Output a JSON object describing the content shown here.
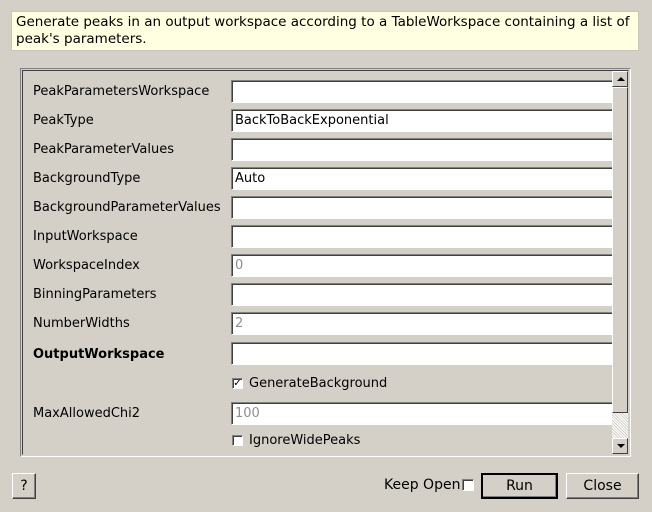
{
  "description": "Generate peaks in an output workspace according to a TableWorkspace containing a list of peak's parameters.",
  "properties": [
    {
      "label": "PeakParametersWorkspace",
      "value": "",
      "bold": false,
      "disabled": false
    },
    {
      "label": "PeakType",
      "value": "BackToBackExponential",
      "bold": false,
      "disabled": false
    },
    {
      "label": "PeakParameterValues",
      "value": "",
      "bold": false,
      "disabled": false
    },
    {
      "label": "BackgroundType",
      "value": "Auto",
      "bold": false,
      "disabled": false
    },
    {
      "label": "BackgroundParameterValues",
      "value": "",
      "bold": false,
      "disabled": false
    },
    {
      "label": "InputWorkspace",
      "value": "",
      "bold": false,
      "disabled": false
    },
    {
      "label": "WorkspaceIndex",
      "value": "0",
      "bold": false,
      "disabled": true
    },
    {
      "label": "BinningParameters",
      "value": "",
      "bold": false,
      "disabled": false
    },
    {
      "label": "NumberWidths",
      "value": "2",
      "bold": false,
      "disabled": true
    },
    {
      "label": "OutputWorkspace",
      "value": "",
      "bold": true,
      "disabled": false
    }
  ],
  "generate_background": {
    "label": "GenerateBackground",
    "checked": true
  },
  "max_allowed_chi2": {
    "label": "MaxAllowedChi2",
    "value": "100"
  },
  "ignore_wide_peaks": {
    "label": "IgnoreWidePeaks",
    "checked": false
  },
  "footer": {
    "help_label": "?",
    "keep_open_label": "Keep Open",
    "keep_open_checked": false,
    "run_label": "Run",
    "close_label": "Close"
  }
}
